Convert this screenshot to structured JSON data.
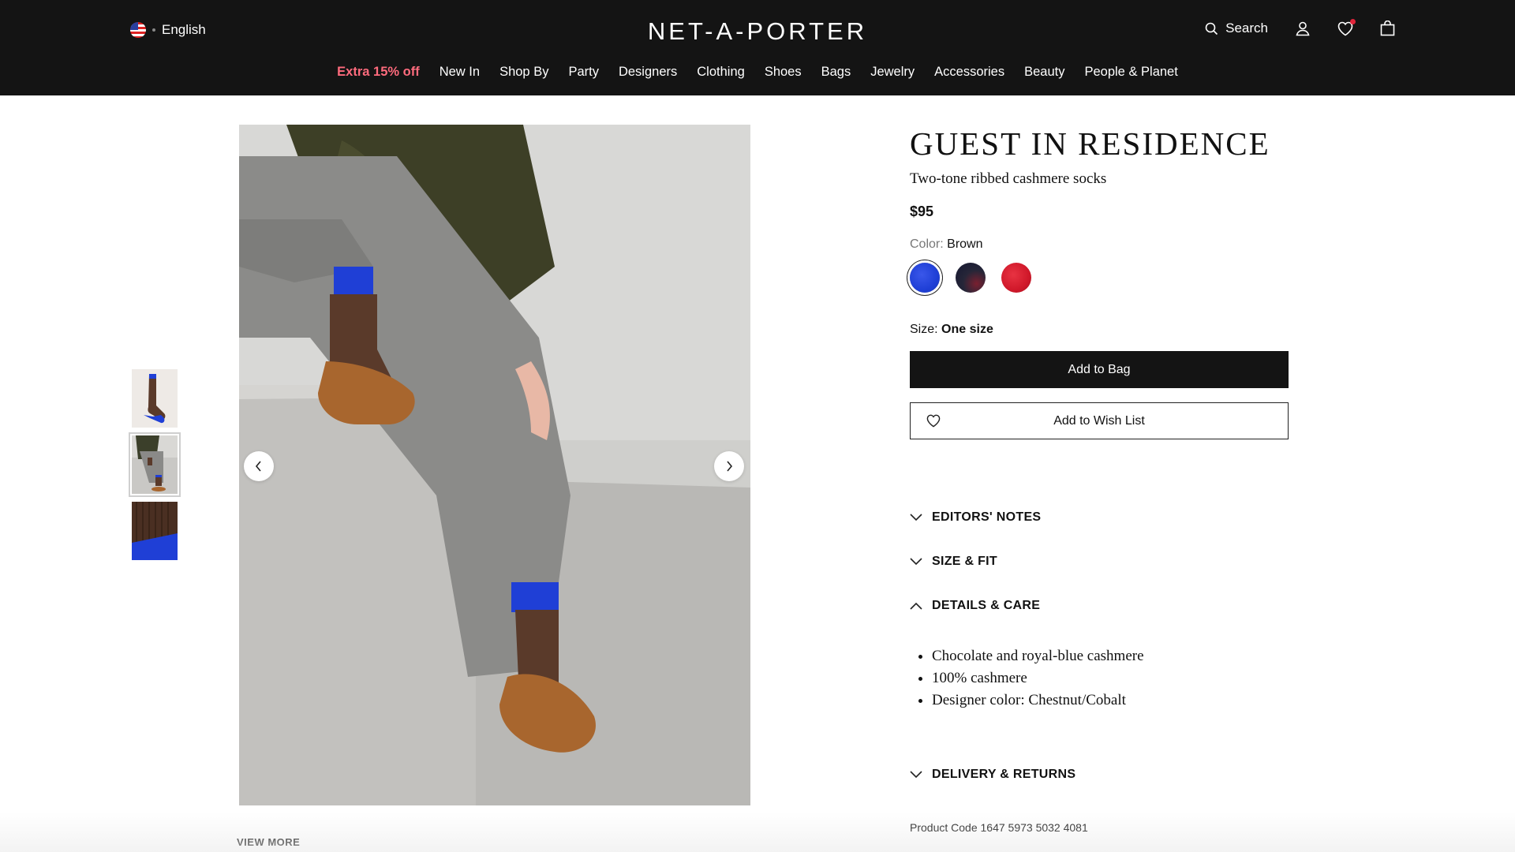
{
  "header": {
    "language": "English",
    "logo": "NET-A-PORTER",
    "search_label": "Search"
  },
  "nav": {
    "items": [
      "Extra 15% off",
      "New In",
      "Shop By",
      "Party",
      "Designers",
      "Clothing",
      "Shoes",
      "Bags",
      "Jewelry",
      "Accessories",
      "Beauty",
      "People & Planet"
    ],
    "promo_color": "#ff6b7d"
  },
  "gallery": {
    "thumbnail_count": 3,
    "active_thumbnail": 2,
    "view_more": "VIEW MORE"
  },
  "product": {
    "brand": "GUEST IN RESIDENCE",
    "name": "Two-tone ribbed cashmere socks",
    "price": "$95",
    "color_label": "Color:",
    "color_value": "Brown",
    "swatches": [
      {
        "name": "blue",
        "color": "#1f3fd6",
        "selected": true
      },
      {
        "name": "navy",
        "color": "#1e1f35",
        "selected": false
      },
      {
        "name": "red",
        "color": "#d0182a",
        "selected": false
      }
    ],
    "size_label": "Size:",
    "size_value": "One size",
    "add_to_bag": "Add to Bag",
    "add_to_wishlist": "Add to Wish List"
  },
  "accordion": {
    "editors_notes": "EDITORS' NOTES",
    "size_fit": "SIZE & FIT",
    "details_care": "DETAILS & CARE",
    "delivery_returns": "DELIVERY & RETURNS"
  },
  "details": [
    "Chocolate and royal-blue cashmere",
    "100% cashmere",
    "Designer color: Chestnut/Cobalt"
  ],
  "product_code": "Product Code 1647 5973 5032 4081"
}
